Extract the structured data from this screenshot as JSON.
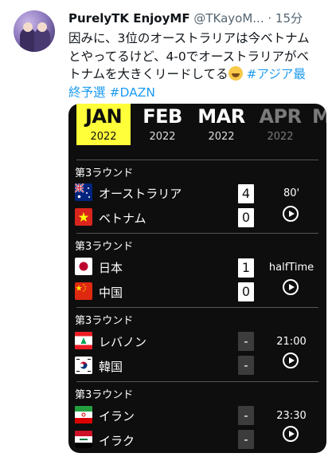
{
  "tweet": {
    "username": "PurelyTK EnjoyMF",
    "handle": "@TKayoM...",
    "time": "· 15分",
    "text_lines": [
      "因みに、3位のオーストラリアは今ベトナム",
      "とやってるけど、4-0でオーストラリアがベ",
      "トナムを大きくリードしてる"
    ],
    "hashtag1_part1": "#アジア最",
    "hashtag1_part2": "終予選",
    "hashtag2": "#DAZN"
  },
  "months": [
    {
      "label": "JAN",
      "year": "2022"
    },
    {
      "label": "FEB",
      "year": "2022"
    },
    {
      "label": "MAR",
      "year": "2022"
    },
    {
      "label": "APR",
      "year": "2022"
    },
    {
      "label": "M",
      "year": ""
    }
  ],
  "matches": [
    {
      "round": "第3ラウンド",
      "home": "オーストラリア",
      "away": "ベトナム",
      "home_score": "4",
      "away_score": "0",
      "status": "80'"
    },
    {
      "round": "第3ラウンド",
      "home": "日本",
      "away": "中国",
      "home_score": "1",
      "away_score": "0",
      "status": "halfTime"
    },
    {
      "round": "第3ラウンド",
      "home": "レバノン",
      "away": "韓国",
      "home_score": "-",
      "away_score": "-",
      "status": "21:00"
    },
    {
      "round": "第3ラウンド",
      "home": "イラン",
      "away": "イラク",
      "home_score": "-",
      "away_score": "-",
      "status": "23:30"
    }
  ],
  "colors": {
    "active_month": "#ffff3a",
    "hashtag": "#1d9bf0",
    "card_bg": "#0e0e0e"
  }
}
